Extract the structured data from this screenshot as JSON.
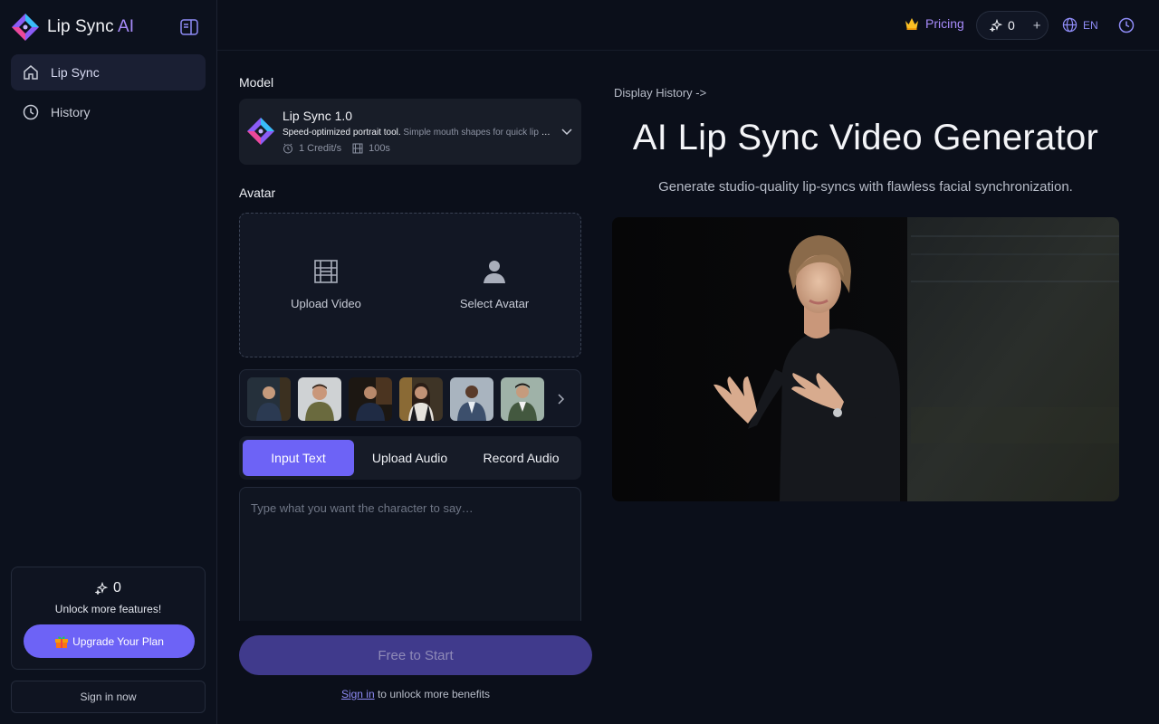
{
  "brand": {
    "name": "Lip Sync",
    "suffix": "AI"
  },
  "sidebar": {
    "items": [
      {
        "label": "Lip Sync",
        "icon": "home-icon",
        "active": true
      },
      {
        "label": "History",
        "icon": "clock-icon",
        "active": false
      }
    ],
    "credits": "0",
    "unlock_text": "Unlock more features!",
    "upgrade_label": "Upgrade Your Plan",
    "signin_label": "Sign in now"
  },
  "topbar": {
    "pricing_label": "Pricing",
    "credits": "0",
    "plus": "+",
    "language": "EN"
  },
  "form": {
    "model_label": "Model",
    "model": {
      "name": "Lip Sync 1.0",
      "desc_bold": "Speed-optimized portrait tool.",
      "desc_rest": "Simple mouth shapes for quick lip sync",
      "rate": "1 Credit/s",
      "duration": "100s"
    },
    "avatar_label": "Avatar",
    "upload_video_label": "Upload Video",
    "select_avatar_label": "Select Avatar",
    "tabs": [
      {
        "label": "Input Text",
        "active": true
      },
      {
        "label": "Upload Audio",
        "active": false
      },
      {
        "label": "Record Audio",
        "active": false
      }
    ],
    "text_placeholder": "Type what you want the character to say…",
    "cta_label": "Free to Start",
    "signin_link": "Sign in",
    "signin_suffix": " to unlock more benefits"
  },
  "hero": {
    "display_history": "Display History ->",
    "title": "AI Lip Sync Video Generator",
    "subtitle": "Generate studio-quality lip-syncs with flawless facial synchronization."
  },
  "colors": {
    "accent": "#6d63f6",
    "accent_text": "#a78bfa",
    "background": "#0b0f1a"
  }
}
